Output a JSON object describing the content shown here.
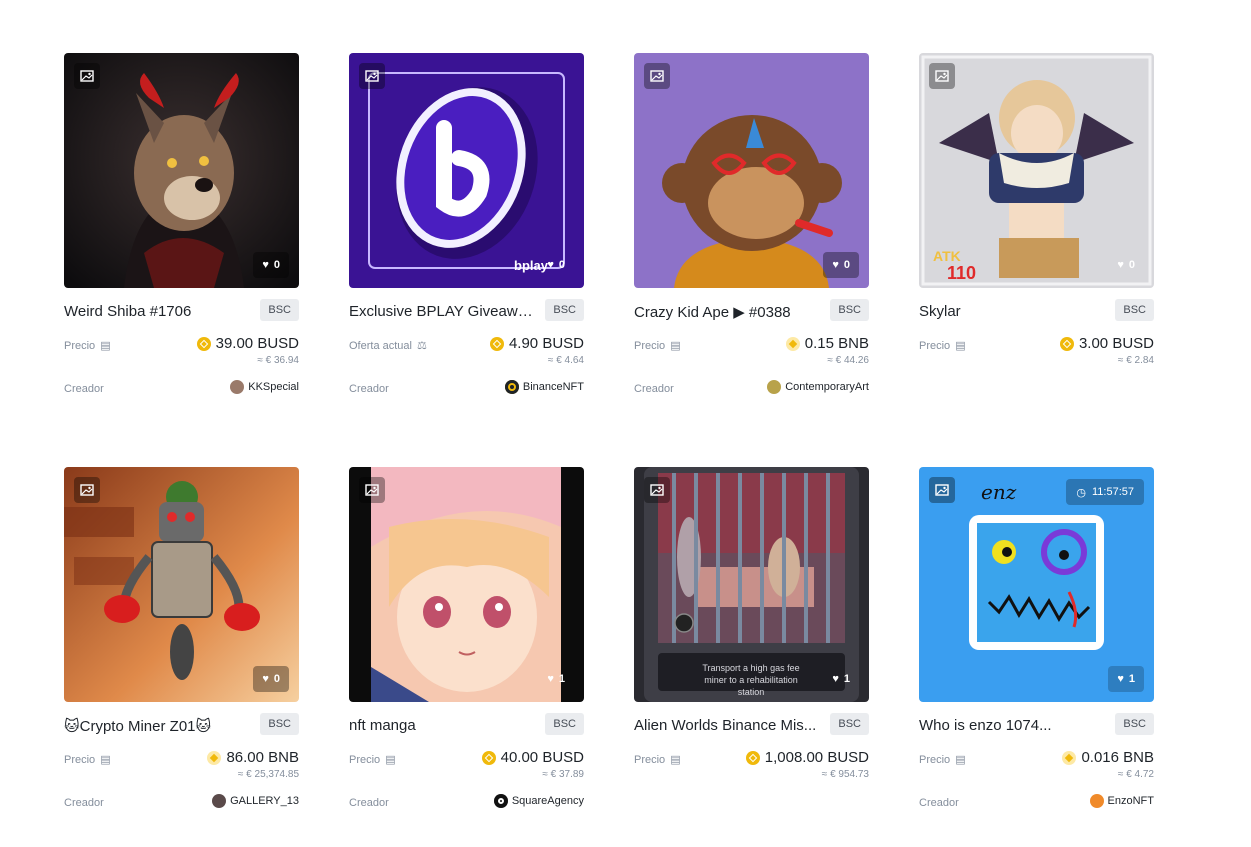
{
  "cards": [
    {
      "title": "Weird Shiba #1706",
      "chain": "BSC",
      "price_label": "Precio",
      "price": "39.00 BUSD",
      "coin": "busd",
      "fiat": "≈ € 36.94",
      "creator_label": "Creador",
      "creator": "KKSpecial",
      "likes": "0"
    },
    {
      "title": "Exclusive BPLAY Giveawa...",
      "chain": "BSC",
      "price_label": "Oferta actual",
      "price": "4.90 BUSD",
      "coin": "busd",
      "fiat": "≈ € 4.64",
      "creator_label": "Creador",
      "creator": "BinanceNFT",
      "likes": "0",
      "brand": "bplay"
    },
    {
      "title": "Crazy Kid Ape ▶ #0388",
      "chain": "BSC",
      "price_label": "Precio",
      "price": "0.15 BNB",
      "coin": "bnb",
      "fiat": "≈ € 44.26",
      "creator_label": "Creador",
      "creator": "ContemporaryArt",
      "likes": "0"
    },
    {
      "title": "Skylar",
      "chain": "BSC",
      "price_label": "Precio",
      "price": "3.00 BUSD",
      "coin": "busd",
      "fiat": "≈ € 2.84",
      "likes": "0",
      "atk_label": "ATK",
      "atk_value": "110"
    },
    {
      "title": "🐱Crypto Miner Z01🐱",
      "chain": "BSC",
      "price_label": "Precio",
      "price": "86.00 BNB",
      "coin": "bnb",
      "fiat": "≈ € 25,374.85",
      "creator_label": "Creador",
      "creator": "GALLERY_13",
      "likes": "0"
    },
    {
      "title": "nft manga",
      "chain": "BSC",
      "price_label": "Precio",
      "price": "40.00 BUSD",
      "coin": "busd",
      "fiat": "≈ € 37.89",
      "creator_label": "Creador",
      "creator": "SquareAgency",
      "likes": "1"
    },
    {
      "title": "Alien Worlds Binance Mis...",
      "chain": "BSC",
      "price_label": "Precio",
      "price": "1,008.00 BUSD",
      "coin": "busd",
      "fiat": "≈ € 954.73",
      "likes": "1",
      "caption": "Transport a high gas fee miner to a rehabilitation station"
    },
    {
      "title": "Who is enzo 1074...",
      "chain": "BSC",
      "price_label": "Precio",
      "price": "0.016 BNB",
      "coin": "bnb",
      "fiat": "≈ € 4.72",
      "creator_label": "Creador",
      "creator": "EnzoNFT",
      "likes": "1",
      "timer": "11:57:57",
      "signature": "enz"
    }
  ]
}
